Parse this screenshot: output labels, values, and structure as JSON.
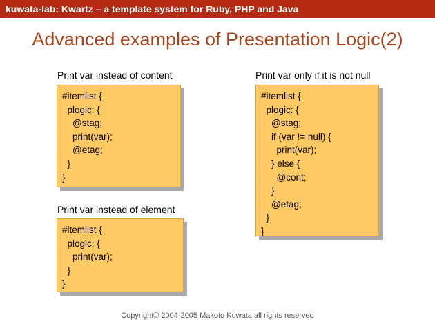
{
  "header": {
    "text": "kuwata-lab:  Kwartz – a template system for Ruby, PHP and Java"
  },
  "slide": {
    "title": "Advanced examples of Presentation Logic(2)"
  },
  "examples": {
    "content": {
      "caption": "Print var instead of content",
      "code": "#itemlist {\n  plogic: {\n    @stag;\n    print(var);\n    @etag;\n  }\n}"
    },
    "element": {
      "caption": "Print var instead of element",
      "code": "#itemlist {\n  plogic: {\n    print(var);\n  }\n}"
    },
    "not_null": {
      "caption": "Print var only if it is not null",
      "code": "#itemlist {\n  plogic: {\n    @stag;\n    if (var != null) {\n      print(var);\n    } else {\n      @cont;\n    }\n    @etag;\n  }\n}"
    }
  },
  "footer": {
    "text": "Copyright© 2004-2005 Makoto Kuwata all rights reserved"
  },
  "colors": {
    "header_bg": "#b42a12",
    "title": "#a8431a",
    "box_fill": "#ffc964",
    "box_shadow": "#a9a9a9"
  }
}
